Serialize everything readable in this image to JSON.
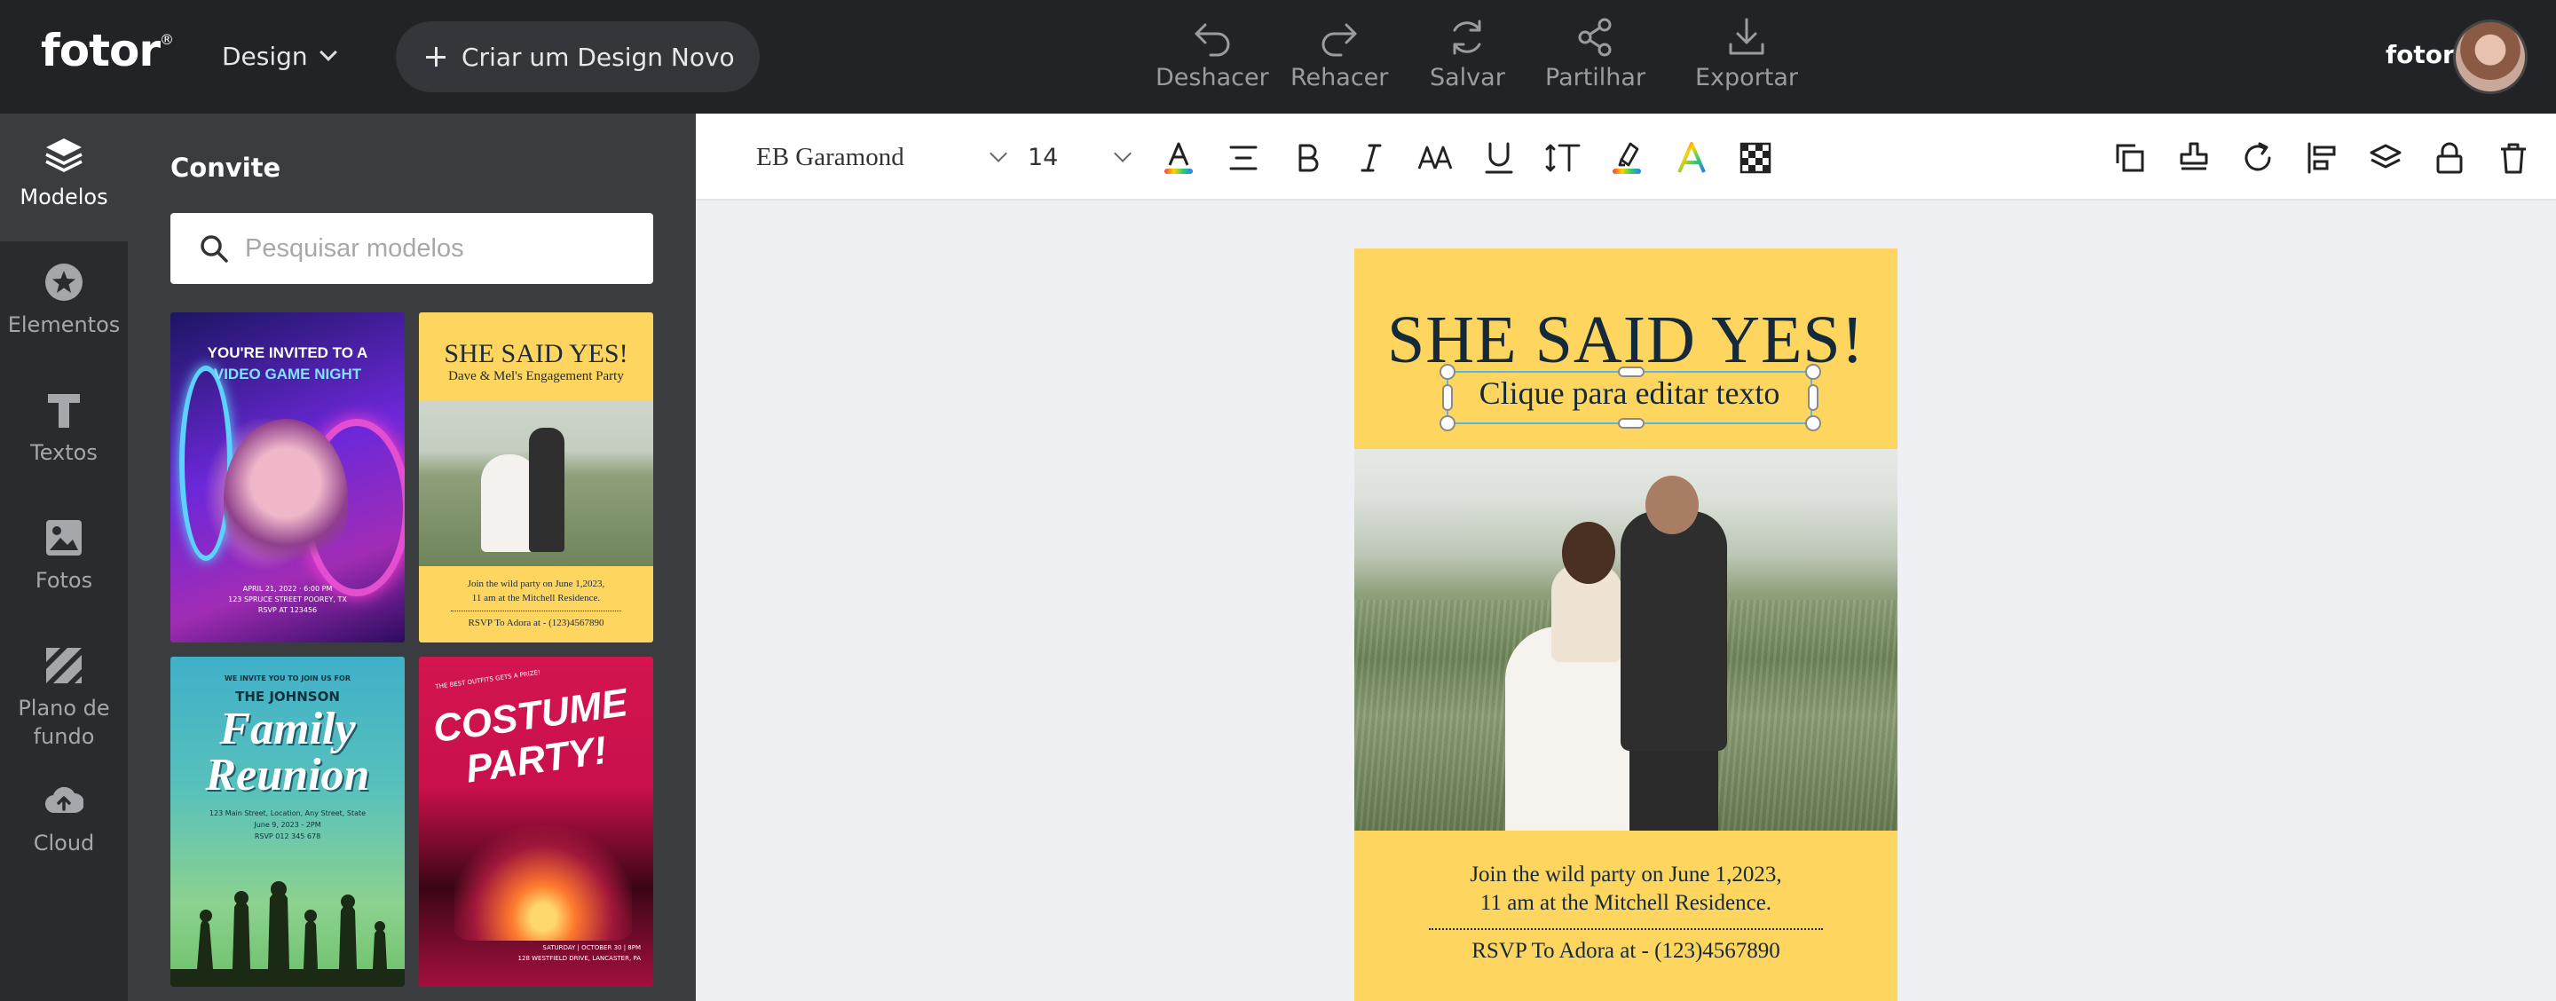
{
  "app": {
    "logo": "fotor",
    "logo_mark": "®",
    "design_menu": "Design",
    "new_design": "Criar um Design Novo"
  },
  "toolbar": {
    "undo": "Deshacer",
    "redo": "Rehacer",
    "save": "Salvar",
    "share": "Partilhar",
    "export": "Exportar"
  },
  "user": {
    "name": "fotor"
  },
  "leftnav": {
    "templates": "Modelos",
    "elements": "Elementos",
    "texts": "Textos",
    "photos": "Fotos",
    "background": "Plano de fundo",
    "cloud": "Cloud"
  },
  "panel": {
    "title": "Convite",
    "search_placeholder": "Pesquisar modelos"
  },
  "thumbs": {
    "t1": {
      "line1": "YOU'RE INVITED TO A",
      "line2": "VIDEO GAME NIGHT",
      "foot": "APRIL 21, 2022 · 6:00 PM\n123 SPRUCE STREET POOREY, TX\nRSVP AT 123456"
    },
    "t2": {
      "title": "SHE SAID YES!",
      "sub": "Dave & Mel's Engagement Party",
      "text": "Join the wild party on June 1,2023,\n11 am at the Mitchell Residence.",
      "rsvp": "RSVP To Adora at - (123)4567890"
    },
    "t3": {
      "small": "WE INVITE YOU TO JOIN US FOR",
      "name": "THE JOHNSON",
      "big": "Family Reunion",
      "info": "123 Main Street, Location, Any Street, State\nJune 9, 2023 - 2PM\nRSVP 012 345 678"
    },
    "t4": {
      "small": "THE BEST OUTFITS GETS A PRIZE!",
      "big": "COSTUME PARTY!",
      "foot": "SATURDAY | OCTOBER 30 | 8PM\n128 WESTFIELD DRIVE, LANCASTER, PA"
    }
  },
  "format": {
    "font": "EB Garamond",
    "size": "14"
  },
  "canvas": {
    "title": "SHE SAID YES!",
    "subtitle": "Clique para editar texto",
    "body": "Join the wild party on June 1,2023,\n11 am at the Mitchell Residence.",
    "rsvp": "RSVP To Adora at - (123)4567890"
  }
}
